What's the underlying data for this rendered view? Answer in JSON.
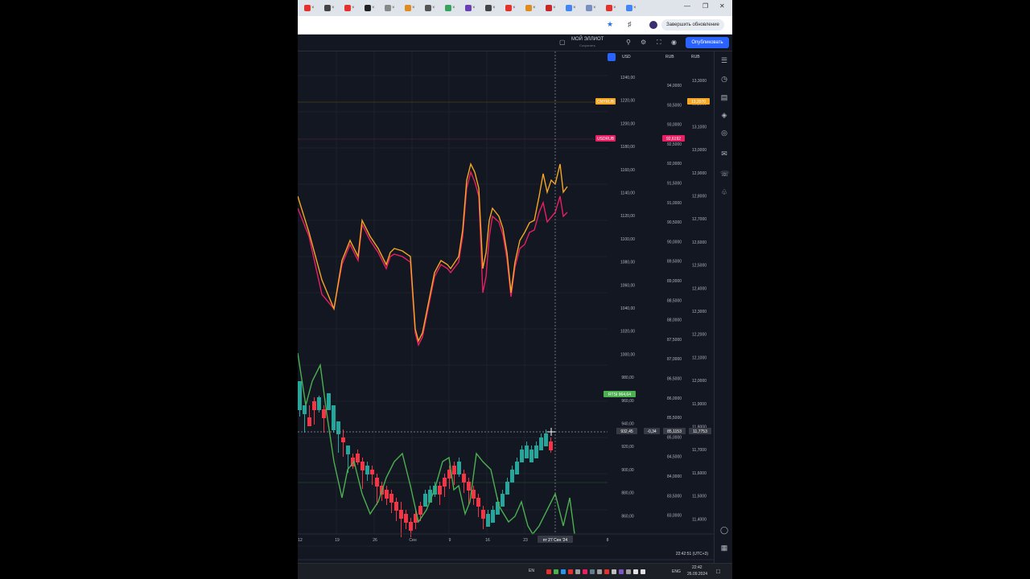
{
  "browser": {
    "tab_favicons": [
      "#e5312c",
      "#444",
      "#e5312c",
      "#222",
      "#888",
      "#e08b1d",
      "#555",
      "#36a35d",
      "#6a3fb0",
      "#444",
      "#e5312c",
      "#e08b1d",
      "#c62828",
      "#4285f4",
      "#7a8ec0",
      "#e5312c",
      "#4285f4"
    ],
    "update_label": "Завершить обновление"
  },
  "toolbar": {
    "layout_name": "МОЙ ЭЛЛИОТ",
    "layout_sub": "Сохранить",
    "publish_label": "Опубликовать"
  },
  "scales": {
    "usd_label": "USD",
    "rub_label_1": "RUB",
    "rub_label_2": "RUB"
  },
  "chart_data": {
    "type": "line",
    "x_labels": [
      "12",
      "19",
      "26",
      "Сен",
      "9",
      "16",
      "23",
      "8"
    ],
    "crosshair_date": "пт 27 Сен '24",
    "axis_usd": [
      "1240,00",
      "1220,00",
      "1200,00",
      "1180,00",
      "1160,00",
      "1140,00",
      "1120,00",
      "1100,00",
      "1080,00",
      "1060,00",
      "1040,00",
      "1020,00",
      "1000,00",
      "980,00",
      "960,00",
      "940,00",
      "920,00",
      "900,00",
      "880,00",
      "860,00"
    ],
    "axis_rub": [
      "94,0000",
      "93,5000",
      "93,0000",
      "92,5000",
      "92,0000",
      "91,5000",
      "91,0000",
      "90,5000",
      "90,0000",
      "89,5000",
      "89,0000",
      "88,5000",
      "88,0000",
      "87,5000",
      "87,0000",
      "86,5000",
      "86,0000",
      "85,5000",
      "85,0000",
      "84,5000",
      "84,0000",
      "83,5000",
      "83,0000"
    ],
    "axis_cny": [
      "13,3000",
      "13,2000",
      "13,1000",
      "13,0000",
      "12,9000",
      "12,8000",
      "12,7000",
      "12,6000",
      "12,5000",
      "12,4000",
      "12,3000",
      "12,2000",
      "12,1000",
      "12,0000",
      "11,9000",
      "11,8000",
      "11,7000",
      "11,6000",
      "11,5000",
      "11,4000"
    ],
    "series": [
      {
        "name": "CNYRUB",
        "color": "#f5a623",
        "last_label": "13,2070"
      },
      {
        "name": "USDRUB",
        "color": "#e91e63",
        "last_label": "92,6192"
      },
      {
        "name": "RTSI",
        "color": "#4caf50",
        "last_label": "964,64"
      }
    ],
    "crosshair_values": {
      "usd": "932,45",
      "change": "-0,34",
      "rub": "85,1153",
      "cny": "11,7753"
    },
    "line_a": [
      [
        0,
        180
      ],
      [
        14,
        225
      ],
      [
        30,
        284
      ],
      [
        45,
        320
      ],
      [
        55,
        260
      ],
      [
        65,
        235
      ],
      [
        75,
        255
      ],
      [
        80,
        210
      ],
      [
        90,
        230
      ],
      [
        100,
        245
      ],
      [
        110,
        265
      ],
      [
        115,
        250
      ],
      [
        120,
        245
      ],
      [
        130,
        248
      ],
      [
        140,
        255
      ],
      [
        146,
        345
      ],
      [
        150,
        360
      ],
      [
        155,
        350
      ],
      [
        165,
        300
      ],
      [
        170,
        275
      ],
      [
        178,
        260
      ],
      [
        186,
        265
      ],
      [
        190,
        270
      ],
      [
        200,
        255
      ],
      [
        205,
        222
      ],
      [
        210,
        160
      ],
      [
        215,
        140
      ],
      [
        220,
        150
      ],
      [
        225,
        170
      ],
      [
        230,
        270
      ],
      [
        234,
        250
      ],
      [
        238,
        210
      ],
      [
        242,
        195
      ],
      [
        250,
        205
      ],
      [
        255,
        220
      ],
      [
        260,
        250
      ],
      [
        265,
        300
      ],
      [
        270,
        262
      ],
      [
        276,
        235
      ],
      [
        282,
        225
      ],
      [
        288,
        213
      ],
      [
        294,
        210
      ],
      [
        300,
        180
      ],
      [
        305,
        152
      ],
      [
        310,
        175
      ],
      [
        315,
        160
      ],
      [
        320,
        165
      ],
      [
        326,
        140
      ],
      [
        330,
        175
      ],
      [
        335,
        168
      ]
    ],
    "line_b": [
      [
        0,
        195
      ],
      [
        14,
        230
      ],
      [
        30,
        302
      ],
      [
        45,
        320
      ],
      [
        55,
        265
      ],
      [
        65,
        240
      ],
      [
        75,
        260
      ],
      [
        80,
        215
      ],
      [
        90,
        235
      ],
      [
        100,
        250
      ],
      [
        110,
        270
      ],
      [
        115,
        255
      ],
      [
        120,
        252
      ],
      [
        130,
        255
      ],
      [
        140,
        262
      ],
      [
        146,
        350
      ],
      [
        150,
        365
      ],
      [
        155,
        355
      ],
      [
        165,
        305
      ],
      [
        170,
        280
      ],
      [
        178,
        265
      ],
      [
        186,
        270
      ],
      [
        190,
        275
      ],
      [
        200,
        262
      ],
      [
        205,
        230
      ],
      [
        210,
        170
      ],
      [
        215,
        150
      ],
      [
        220,
        162
      ],
      [
        225,
        180
      ],
      [
        230,
        300
      ],
      [
        234,
        280
      ],
      [
        238,
        230
      ],
      [
        242,
        205
      ],
      [
        250,
        212
      ],
      [
        255,
        228
      ],
      [
        260,
        258
      ],
      [
        265,
        305
      ],
      [
        270,
        268
      ],
      [
        276,
        245
      ],
      [
        282,
        240
      ],
      [
        288,
        225
      ],
      [
        294,
        222
      ],
      [
        300,
        200
      ],
      [
        305,
        188
      ],
      [
        310,
        212
      ],
      [
        315,
        206
      ],
      [
        320,
        200
      ],
      [
        326,
        180
      ],
      [
        330,
        205
      ],
      [
        335,
        200
      ]
    ],
    "line_c": [
      [
        0,
        375
      ],
      [
        10,
        440
      ],
      [
        18,
        410
      ],
      [
        28,
        390
      ],
      [
        36,
        450
      ],
      [
        45,
        510
      ],
      [
        55,
        555
      ],
      [
        62,
        520
      ],
      [
        70,
        510
      ],
      [
        80,
        550
      ],
      [
        90,
        575
      ],
      [
        100,
        560
      ],
      [
        110,
        530
      ],
      [
        120,
        510
      ],
      [
        130,
        500
      ],
      [
        140,
        540
      ],
      [
        150,
        585
      ],
      [
        160,
        570
      ],
      [
        170,
        545
      ],
      [
        180,
        510
      ],
      [
        188,
        505
      ],
      [
        194,
        545
      ],
      [
        200,
        540
      ],
      [
        208,
        575
      ],
      [
        214,
        560
      ],
      [
        222,
        500
      ],
      [
        230,
        510
      ],
      [
        240,
        520
      ],
      [
        250,
        565
      ],
      [
        262,
        585
      ],
      [
        270,
        578
      ],
      [
        278,
        560
      ],
      [
        286,
        590
      ],
      [
        292,
        600
      ],
      [
        300,
        590
      ],
      [
        310,
        570
      ],
      [
        320,
        550
      ],
      [
        330,
        590
      ],
      [
        338,
        555
      ],
      [
        344,
        600
      ]
    ],
    "candles": [
      [
        0,
        440,
        410,
        450,
        430
      ],
      [
        6,
        445,
        440,
        470,
        460
      ],
      [
        12,
        455,
        460,
        450,
        440
      ],
      [
        18,
        435,
        440,
        460,
        430
      ],
      [
        24,
        440,
        430,
        445,
        428
      ],
      [
        30,
        445,
        450,
        470,
        440
      ],
      [
        36,
        440,
        425,
        430,
        440
      ],
      [
        42,
        465,
        440,
        470,
        460
      ],
      [
        48,
        470,
        460,
        495,
        480
      ],
      [
        54,
        480,
        480,
        500,
        470
      ],
      [
        60,
        495,
        490,
        520,
        500
      ],
      [
        66,
        505,
        510,
        515,
        500
      ],
      [
        72,
        500,
        505,
        510,
        495
      ],
      [
        78,
        510,
        515,
        540,
        505
      ],
      [
        84,
        520,
        515,
        530,
        510
      ],
      [
        90,
        520,
        520,
        535,
        515
      ],
      [
        96,
        530,
        535,
        560,
        525
      ],
      [
        102,
        540,
        545,
        555,
        535
      ],
      [
        108,
        545,
        550,
        560,
        540
      ],
      [
        114,
        550,
        555,
        570,
        545
      ],
      [
        120,
        560,
        565,
        580,
        555
      ],
      [
        126,
        570,
        575,
        600,
        560
      ],
      [
        132,
        575,
        580,
        590,
        570
      ],
      [
        138,
        585,
        590,
        600,
        580
      ],
      [
        144,
        575,
        580,
        590,
        570
      ],
      [
        150,
        565,
        570,
        580,
        560
      ],
      [
        156,
        560,
        550,
        545,
        555
      ],
      [
        162,
        555,
        545,
        540,
        540
      ],
      [
        168,
        545,
        540,
        550,
        535
      ],
      [
        174,
        540,
        545,
        560,
        535
      ],
      [
        180,
        530,
        535,
        550,
        525
      ],
      [
        186,
        520,
        525,
        540,
        515
      ],
      [
        192,
        515,
        520,
        535,
        510
      ],
      [
        198,
        520,
        510,
        525,
        505
      ],
      [
        204,
        525,
        530,
        545,
        520
      ],
      [
        210,
        535,
        540,
        560,
        530
      ],
      [
        216,
        545,
        550,
        560,
        540
      ],
      [
        222,
        555,
        560,
        575,
        550
      ],
      [
        228,
        570,
        575,
        590,
        565
      ],
      [
        234,
        585,
        575,
        580,
        570
      ],
      [
        240,
        580,
        570,
        575,
        565
      ],
      [
        246,
        570,
        560,
        565,
        555
      ],
      [
        252,
        560,
        550,
        555,
        545
      ],
      [
        258,
        545,
        535,
        540,
        530
      ],
      [
        264,
        530,
        520,
        525,
        515
      ],
      [
        270,
        520,
        510,
        515,
        505
      ],
      [
        276,
        505,
        495,
        500,
        490
      ],
      [
        282,
        500,
        490,
        495,
        485
      ],
      [
        288,
        505,
        495,
        500,
        490
      ],
      [
        294,
        500,
        490,
        495,
        485
      ],
      [
        300,
        490,
        480,
        485,
        475
      ],
      [
        306,
        485,
        475,
        480,
        470
      ],
      [
        312,
        485,
        490,
        495,
        480
      ]
    ]
  },
  "status": {
    "clock_utc": "22:42:51 (UTC+3)",
    "lang": "EN",
    "lang2": "ENG",
    "time": "22:42",
    "date": "26.09.2024"
  }
}
